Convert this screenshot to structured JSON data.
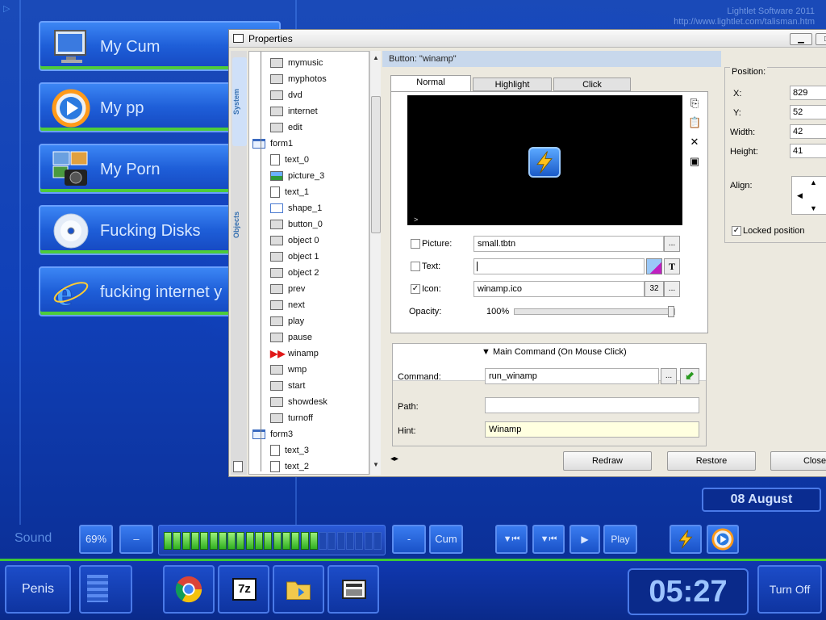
{
  "desktop": {
    "brand_line1": "Lightlet Software 2011",
    "brand_line2": "http://www.lightlet.com/talisman.htm",
    "menu": [
      {
        "label": "My Cum",
        "icon": "monitor-icon"
      },
      {
        "label": "My pp",
        "icon": "media-player-icon"
      },
      {
        "label": "My Porn",
        "icon": "camera-photos-icon"
      },
      {
        "label": "Fucking Disks",
        "icon": "disc-icon"
      },
      {
        "label": "fucking internet y",
        "icon": "internet-explorer-icon"
      }
    ]
  },
  "dialog": {
    "title": "Properties",
    "vtabs": [
      "System",
      "Objects"
    ],
    "header": "Button: \"winamp\"",
    "tree": [
      {
        "label": "mymusic",
        "type": "button",
        "level": 2
      },
      {
        "label": "myphotos",
        "type": "button",
        "level": 2
      },
      {
        "label": "dvd",
        "type": "button",
        "level": 2
      },
      {
        "label": "internet",
        "type": "button",
        "level": 2
      },
      {
        "label": "edit",
        "type": "button",
        "level": 2
      },
      {
        "label": "form1",
        "type": "form",
        "level": 1
      },
      {
        "label": "text_0",
        "type": "text",
        "level": 2
      },
      {
        "label": "picture_3",
        "type": "picture",
        "level": 2
      },
      {
        "label": "text_1",
        "type": "text",
        "level": 2
      },
      {
        "label": "shape_1",
        "type": "shape",
        "level": 2
      },
      {
        "label": "button_0",
        "type": "button",
        "level": 2
      },
      {
        "label": "object 0",
        "type": "button",
        "level": 2
      },
      {
        "label": "object 1",
        "type": "button",
        "level": 2
      },
      {
        "label": "object 2",
        "type": "button",
        "level": 2
      },
      {
        "label": "prev",
        "type": "button",
        "level": 2
      },
      {
        "label": "next",
        "type": "button",
        "level": 2
      },
      {
        "label": "play",
        "type": "button",
        "level": 2
      },
      {
        "label": "pause",
        "type": "button",
        "level": 2
      },
      {
        "label": "winamp",
        "type": "selected",
        "level": 2
      },
      {
        "label": "wmp",
        "type": "button",
        "level": 2
      },
      {
        "label": "start",
        "type": "button",
        "level": 2
      },
      {
        "label": "showdesk",
        "type": "button",
        "level": 2
      },
      {
        "label": "turnoff",
        "type": "button",
        "level": 2
      },
      {
        "label": "form3",
        "type": "form",
        "level": 1
      },
      {
        "label": "text_3",
        "type": "text",
        "level": 2
      },
      {
        "label": "text_2",
        "type": "text",
        "level": 2
      }
    ],
    "state_tabs": [
      "Normal",
      "Highlight",
      "Click"
    ],
    "preview_mark": ">",
    "picture_label": "Picture:",
    "picture_value": "small.tbtn",
    "text_label": "Text:",
    "text_value": "",
    "icon_label": "Icon:",
    "icon_value": "winamp.ico",
    "icon_size": "32",
    "opacity_label": "Opacity:",
    "opacity_value": "100%",
    "opacity_fraction": 1.0,
    "browse": "...",
    "text_style_button": "T",
    "position_legend": "Position:",
    "x_label": "X:",
    "x_value": "829",
    "y_label": "Y:",
    "y_value": "52",
    "width_label": "Width:",
    "width_value": "42",
    "height_label": "Height:",
    "height_value": "41",
    "align_label": "Align:",
    "locked_label": "Locked position",
    "main_command": "Main Command (On Mouse Click)",
    "command_label": "Command:",
    "command_value": "run_winamp",
    "path_label": "Path:",
    "path_value": "",
    "hint_label": "Hint:",
    "hint_value": "Winamp",
    "redraw": "Redraw",
    "restore": "Restore",
    "close": "Close"
  },
  "bottom": {
    "sound_label": "Sound",
    "volume_percent": "69%",
    "volume_fraction": 0.69,
    "minus": "–",
    "dash": "-",
    "cum": "Cum",
    "play": "Play",
    "date": "08 August",
    "time": "05:27",
    "start": "Penis",
    "turn_off": "Turn Off",
    "taskbar_icons": [
      "chrome-icon",
      "7zip-icon",
      "folder-icon",
      "window-manager-icon"
    ]
  }
}
